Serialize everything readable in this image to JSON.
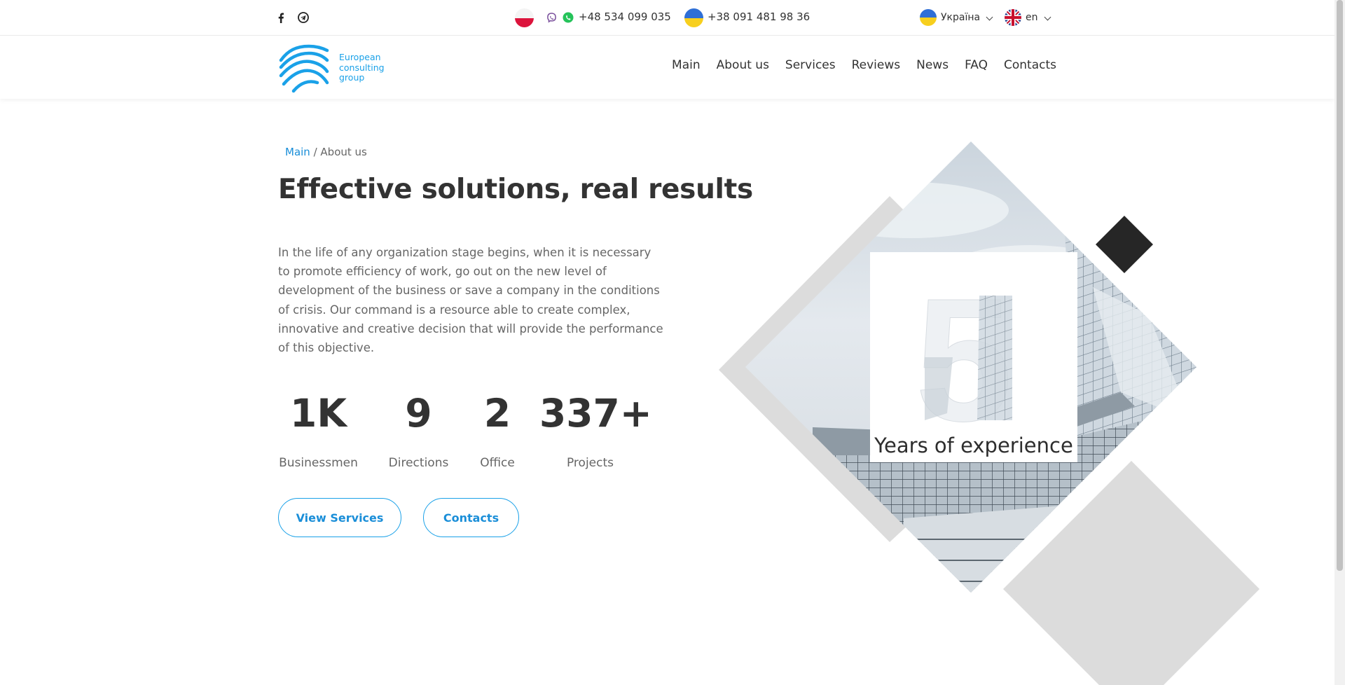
{
  "topbar": {
    "social": [
      {
        "name": "facebook",
        "icon": "facebook-icon"
      },
      {
        "name": "telegram",
        "icon": "telegram-icon"
      }
    ],
    "phone_pl": "+48 534 099 035",
    "phone_ua": "+38 091 481 98 36",
    "region_label": "Україна",
    "language_label": "en"
  },
  "header": {
    "logo_text": "European consulting group",
    "nav": [
      "Main",
      "About us",
      "Services",
      "Reviews",
      "News",
      "FAQ",
      "Contacts"
    ]
  },
  "breadcrumb": {
    "home": "Main",
    "separator": " / ",
    "current": "About us"
  },
  "hero": {
    "title": "Effective solutions, real results",
    "description": "In the life of any organization stage begins, when it is necessary to promote efficiency of work, go out on the new level of development of the business or save a company in the conditions of crisis. Our command is a resource able to create complex, innovative and creative decision that will provide the performance of this objective."
  },
  "stats": [
    {
      "value": "1K",
      "label": "Businessmen"
    },
    {
      "value": "9",
      "label": "Directions"
    },
    {
      "value": "2",
      "label": "Office"
    },
    {
      "value": "337+",
      "label": "Projects"
    }
  ],
  "buttons": {
    "services": "View Services",
    "contacts": "Contacts"
  },
  "experience": {
    "number": "5",
    "label": "Years of experience"
  },
  "colors": {
    "accent": "#1aa1e8",
    "text": "#333333",
    "muted": "#666666",
    "shape_gray": "#dcdcdc",
    "shape_dark": "#262626"
  }
}
